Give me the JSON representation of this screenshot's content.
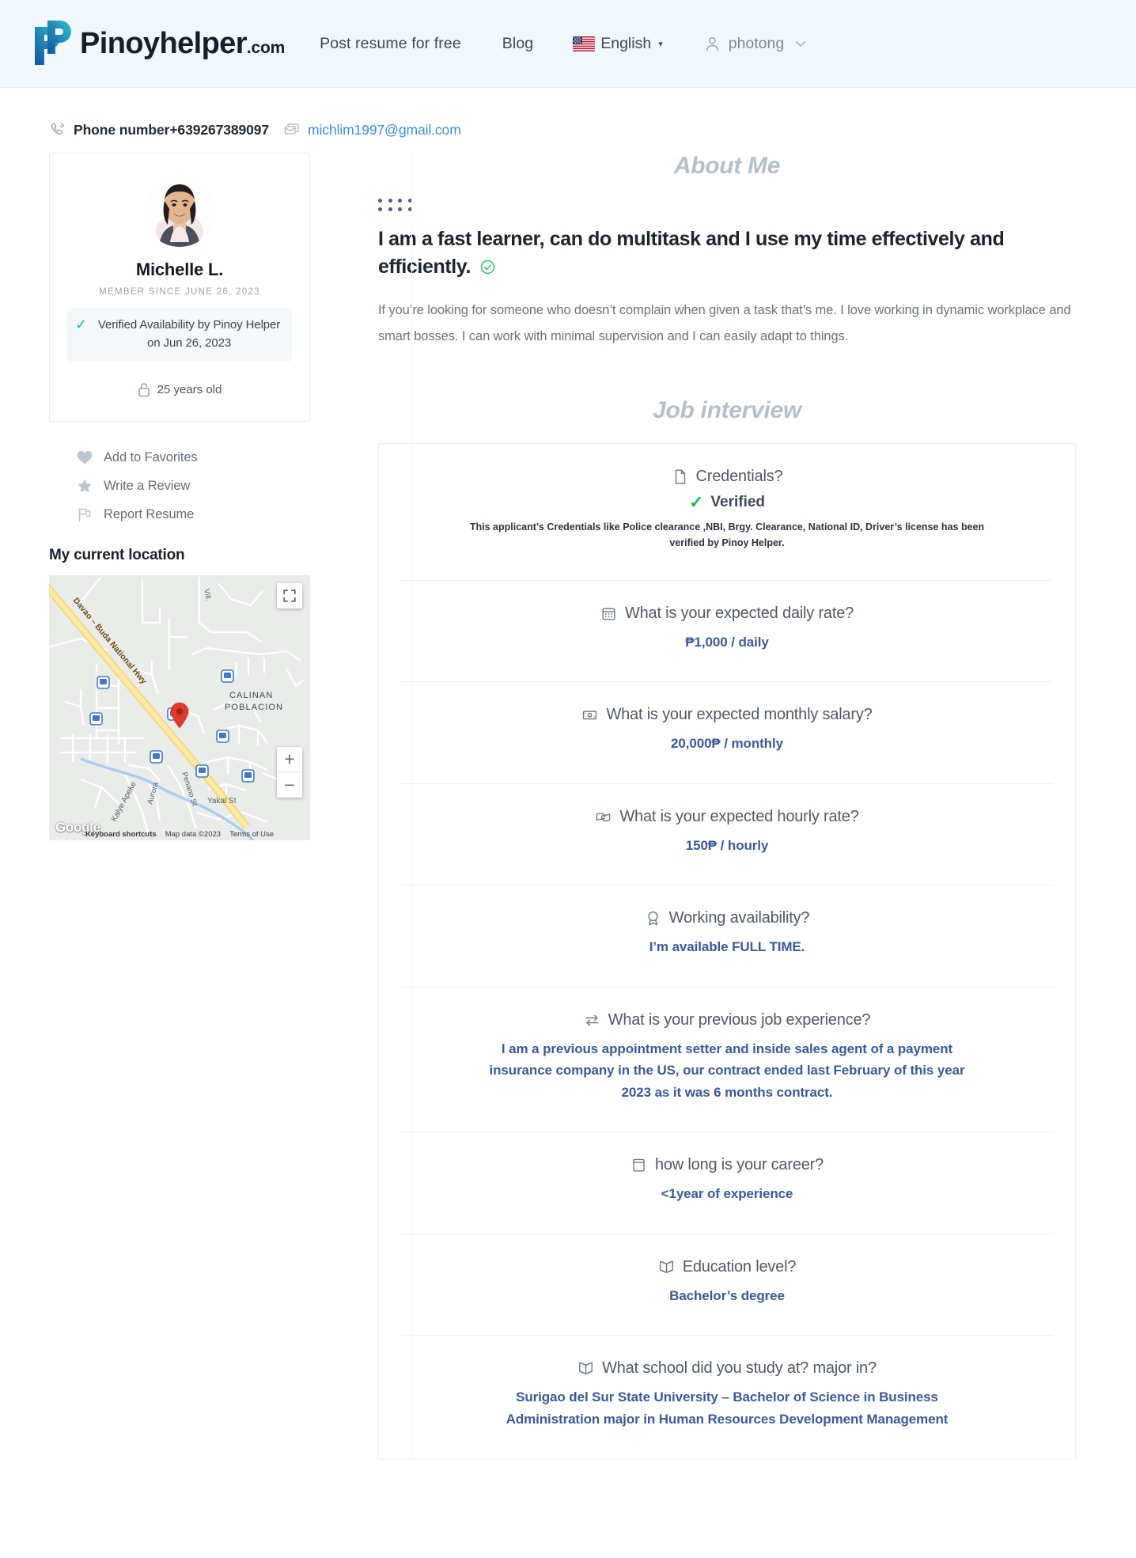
{
  "header": {
    "logo_text": "Pinoyhelper",
    "logo_suffix": ".com",
    "nav": [
      {
        "label": "Post resume for free",
        "name": "nav-post-resume"
      },
      {
        "label": "Blog",
        "name": "nav-blog"
      }
    ],
    "language": {
      "label": "English",
      "flag": "us-flag-icon",
      "caret": "▾"
    },
    "user": {
      "name": "photong",
      "icon": "user-icon"
    }
  },
  "contact": {
    "phone_label": "Phone number",
    "phone_number": "+639267389097",
    "email": "michlim1997@gmail.com"
  },
  "profile": {
    "name": "Michelle L.",
    "member_since": "MEMBER SINCE JUNE 26, 2023",
    "verified_availability": "Verified Availability by Pinoy Helper on Jun 26, 2023",
    "age": "25 years old"
  },
  "actions": [
    {
      "label": "Add to Favorites",
      "icon": "heart-icon",
      "name": "add-to-favorites"
    },
    {
      "label": "Write a Review",
      "icon": "star-icon",
      "name": "write-a-review"
    },
    {
      "label": "Report Resume",
      "icon": "flag-icon",
      "name": "report-resume"
    }
  ],
  "map": {
    "title": "My current location",
    "labels": {
      "highway": "Davao – Buda National Hwy",
      "aurora": "Aurora",
      "vill": "Vill.",
      "calinan_1": "CALINAN",
      "calinan_2": "POBLACION",
      "kalye_apeke": "Kalye Apeke",
      "penano": "Penano St",
      "yakal": "Yakal St"
    },
    "watermark": "Google",
    "credits": {
      "keyboard": "Keyboard shortcuts",
      "mapdata": "Map data ©2023",
      "terms": "Terms of Use"
    },
    "zoom_in": "+",
    "zoom_out": "−"
  },
  "about": {
    "title": "About Me",
    "headline": "I am a fast learner, can do multitask and I use my time effectively and efficiently.",
    "body": "If you’re looking for someone who doesn’t complain when given a task that’s me. I love working in dynamic workplace and smart bosses. I can work with minimal supervision and I can easily adapt to things."
  },
  "job_interview": {
    "title": "Job interview",
    "items": [
      {
        "question": "Credentials?",
        "icon": "document-icon",
        "verified_label": "Verified",
        "note": "This applicant’s Credentials like Police clearance ,NBI, Brgy. Clearance, National ID, Driver’s license has been verified by Pinoy Helper.",
        "answer": ""
      },
      {
        "question": "What is your expected daily rate?",
        "icon": "calendar-icon",
        "answer": "₱1,000 / daily"
      },
      {
        "question": "What is your expected monthly salary?",
        "icon": "banknote-icon",
        "answer": "20,000₱ / monthly"
      },
      {
        "question": "What is your expected hourly rate?",
        "icon": "cash-icon",
        "answer": "150₱ / hourly"
      },
      {
        "question": "Working availability?",
        "icon": "award-icon",
        "answer": "I’m available FULL TIME."
      },
      {
        "question": "What is your previous job experience?",
        "icon": "transfer-icon",
        "answer": "I am a previous appointment setter and inside sales agent of a payment insurance company in the US, our contract ended last February of this year 2023 as it was 6 months contract."
      },
      {
        "question": "how long is your career?",
        "icon": "archive-icon",
        "answer": "<1year of experience"
      },
      {
        "question": "Education level?",
        "icon": "book-icon",
        "answer": "Bachelor’s degree"
      },
      {
        "question": "What school did you study at? major in?",
        "icon": "book-icon",
        "answer": "Surigao del Sur State University – Bachelor of Science in Business Administration major in Human Resources Development Management"
      }
    ]
  },
  "colors": {
    "brand_blue": "#1565b8",
    "brand_teal": "#28b4c8",
    "link_blue": "#3d8fd6",
    "answer_blue": "#3b5a96",
    "verified_green": "#22bb55",
    "check_teal": "#14b8a6",
    "header_bg": "#f2f8fd"
  }
}
